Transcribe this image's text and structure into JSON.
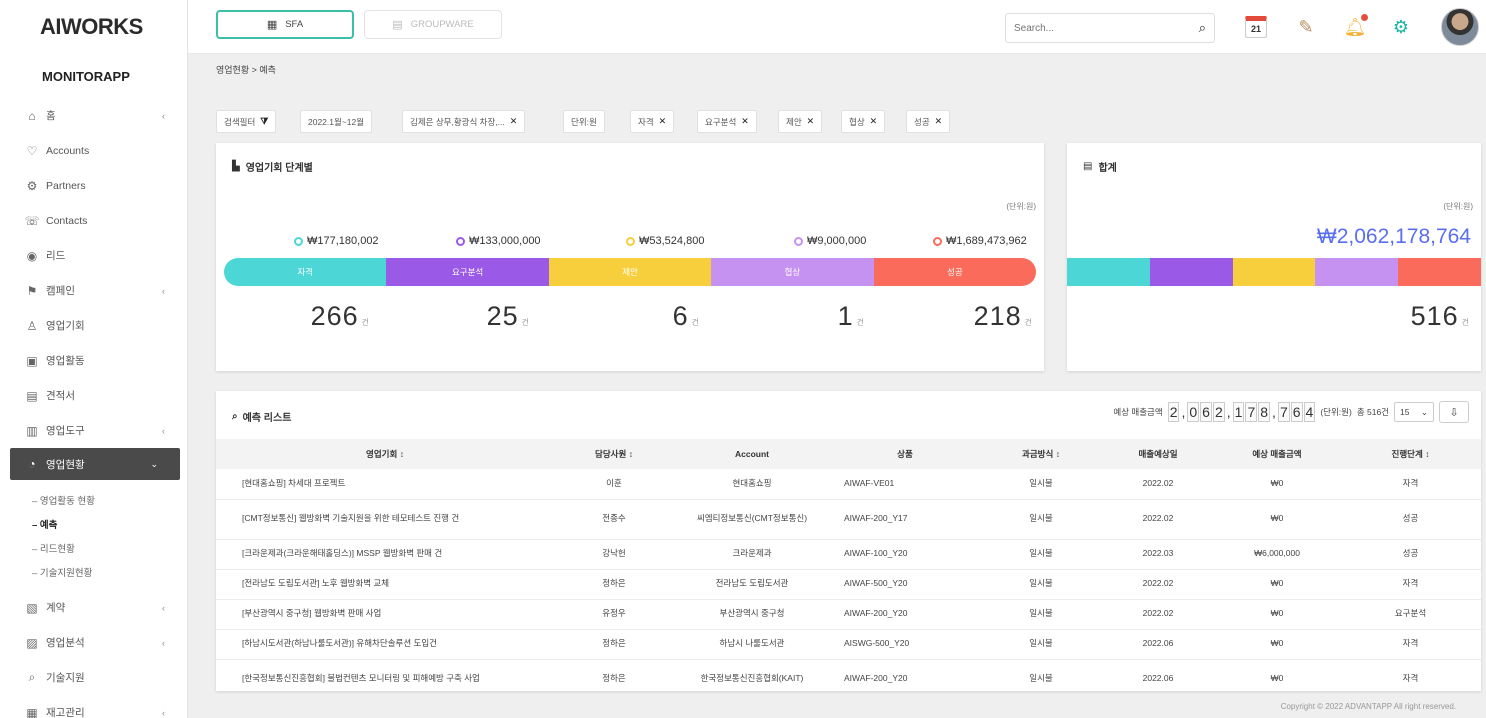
{
  "app": {
    "logo": "AIWORKS",
    "brand": "MONITORAPP"
  },
  "sidebar": {
    "items": [
      {
        "label": "홈",
        "icon": "home-icon",
        "glyph": "⌂",
        "chev": true
      },
      {
        "label": "Accounts",
        "icon": "accounts-icon",
        "glyph": "♡",
        "chev": false
      },
      {
        "label": "Partners",
        "icon": "partners-icon",
        "glyph": "⚙",
        "chev": false
      },
      {
        "label": "Contacts",
        "icon": "contacts-icon",
        "glyph": "☏",
        "chev": false
      },
      {
        "label": "리드",
        "icon": "lead-icon",
        "glyph": "◉",
        "chev": false
      },
      {
        "label": "캠페인",
        "icon": "campaign-icon",
        "glyph": "⚑",
        "chev": true
      },
      {
        "label": "영업기회",
        "icon": "opportunity-icon",
        "glyph": "♙",
        "chev": false
      },
      {
        "label": "영업활동",
        "icon": "activity-icon",
        "glyph": "▣",
        "chev": false
      },
      {
        "label": "견적서",
        "icon": "quote-icon",
        "glyph": "▤",
        "chev": false
      },
      {
        "label": "영업도구",
        "icon": "tools-icon",
        "glyph": "▥",
        "chev": true
      },
      {
        "label": "영업현황",
        "icon": "status-icon",
        "glyph": "◔",
        "chev": true,
        "active": true
      }
    ],
    "sub": [
      "영업활동 현황",
      "예측",
      "리드현황",
      "기술지원현황"
    ],
    "items_after": [
      {
        "label": "계약",
        "icon": "contract-icon",
        "glyph": "▧",
        "chev": true
      },
      {
        "label": "영업분석",
        "icon": "analysis-icon",
        "glyph": "▨",
        "chev": true
      },
      {
        "label": "기술지원",
        "icon": "support-icon",
        "glyph": "⌕",
        "chev": false
      },
      {
        "label": "재고관리",
        "icon": "inventory-icon",
        "glyph": "▦",
        "chev": true
      }
    ]
  },
  "topbar": {
    "tab_sfa": "SFA",
    "tab_groupware": "GROUPWARE",
    "search_placeholder": "Search...",
    "calendar_day": "21"
  },
  "breadcrumb": "영업현황 > 예측",
  "filters": [
    {
      "label": "검색필터",
      "icon": "filter-icon"
    },
    {
      "label": "2022.1월~12월"
    },
    {
      "label": "김제은 상무,황광식 차장,...",
      "x": true
    },
    {
      "label": "단위:원"
    },
    {
      "label": "자격",
      "x": true
    },
    {
      "label": "요구분석",
      "x": true
    },
    {
      "label": "제안",
      "x": true
    },
    {
      "label": "협상",
      "x": true
    },
    {
      "label": "성공",
      "x": true
    }
  ],
  "stage_card": {
    "title": "영업기회 단계별",
    "unit": "(단위:원)",
    "stages": [
      {
        "name": "자격",
        "amount": "₩177,180,002",
        "count": "266",
        "color": "#4dd6d6"
      },
      {
        "name": "요구분석",
        "amount": "₩133,000,000",
        "count": "25",
        "color": "#9b59e8"
      },
      {
        "name": "제안",
        "amount": "₩53,524,800",
        "count": "6",
        "color": "#f7cf3c"
      },
      {
        "name": "협상",
        "amount": "₩9,000,000",
        "count": "1",
        "color": "#c592f2"
      },
      {
        "name": "성공",
        "amount": "₩1,689,473,962",
        "count": "218",
        "color": "#fa6b5b"
      }
    ],
    "count_unit": "건"
  },
  "total_card": {
    "title": "합계",
    "unit": "(단위:원)",
    "amount": "₩2,062,178,764",
    "count": "516",
    "count_unit": "건"
  },
  "list": {
    "title": "예측 리스트",
    "expected_label": "예상 매출금액",
    "digits": [
      "2",
      ",",
      "0",
      "6",
      "2",
      ",",
      "1",
      "7",
      "8",
      ",",
      "7",
      "6",
      "4"
    ],
    "unit": "(단위:원)",
    "total": "총 516건",
    "page_size": "15",
    "columns": [
      "영업기회 ↕",
      "담당사원 ↕",
      "Account",
      "상품",
      "과금방식 ↕",
      "매출예상일",
      "예상 매출금액",
      "진행단계 ↕"
    ],
    "rows": [
      [
        "[현대홈쇼핑] 차세대 프로젝트",
        "이훈",
        "현대홈쇼핑",
        "AIWAF-VE01",
        "일시불",
        "2022.02",
        "₩0",
        "자격"
      ],
      [
        "[CMT정보통신] 웹방화벽 기술지원을 위한 테모테스트 진행 건",
        "전종수",
        "씨엠티정보통신(CMT정보통신)",
        "AIWAF-200_Y17",
        "일시불",
        "2022.02",
        "₩0",
        "성공"
      ],
      [
        "[크라운제과(크라운해태홀딩스)] MSSP 웹방화벽 판매 건",
        "강낙헌",
        "크라운제과",
        "AIWAF-100_Y20",
        "일시불",
        "2022.03",
        "₩6,000,000",
        "성공"
      ],
      [
        "[전라남도 도립도서관] 노후 웹방화벽 교체",
        "정하은",
        "전라남도 도립도서관",
        "AIWAF-500_Y20",
        "일시불",
        "2022.02",
        "₩0",
        "자격"
      ],
      [
        "[부산광역시 중구청] 웹방화벽 판매 사업",
        "유정우",
        "부산광역시 중구청",
        "AIWAF-200_Y20",
        "일시불",
        "2022.02",
        "₩0",
        "요구분석"
      ],
      [
        "[하남시도서관(하남나룰도서관)] 유해차단솔루션 도입건",
        "정하은",
        "하남시 나룰도서관",
        "AISWG-500_Y20",
        "일시불",
        "2022.06",
        "₩0",
        "자격"
      ],
      [
        "[한국정보통신진흥협회] 불법컨텐츠 모니터링 및 피해예방 구축 사업",
        "정하은",
        "한국정보통신진흥협회(KAIT)",
        "AIWAF-200_Y20",
        "일시불",
        "2022.06",
        "₩0",
        "자격"
      ]
    ]
  },
  "copyright": "Copyright © 2022 ADVANTAPP All right reserved."
}
